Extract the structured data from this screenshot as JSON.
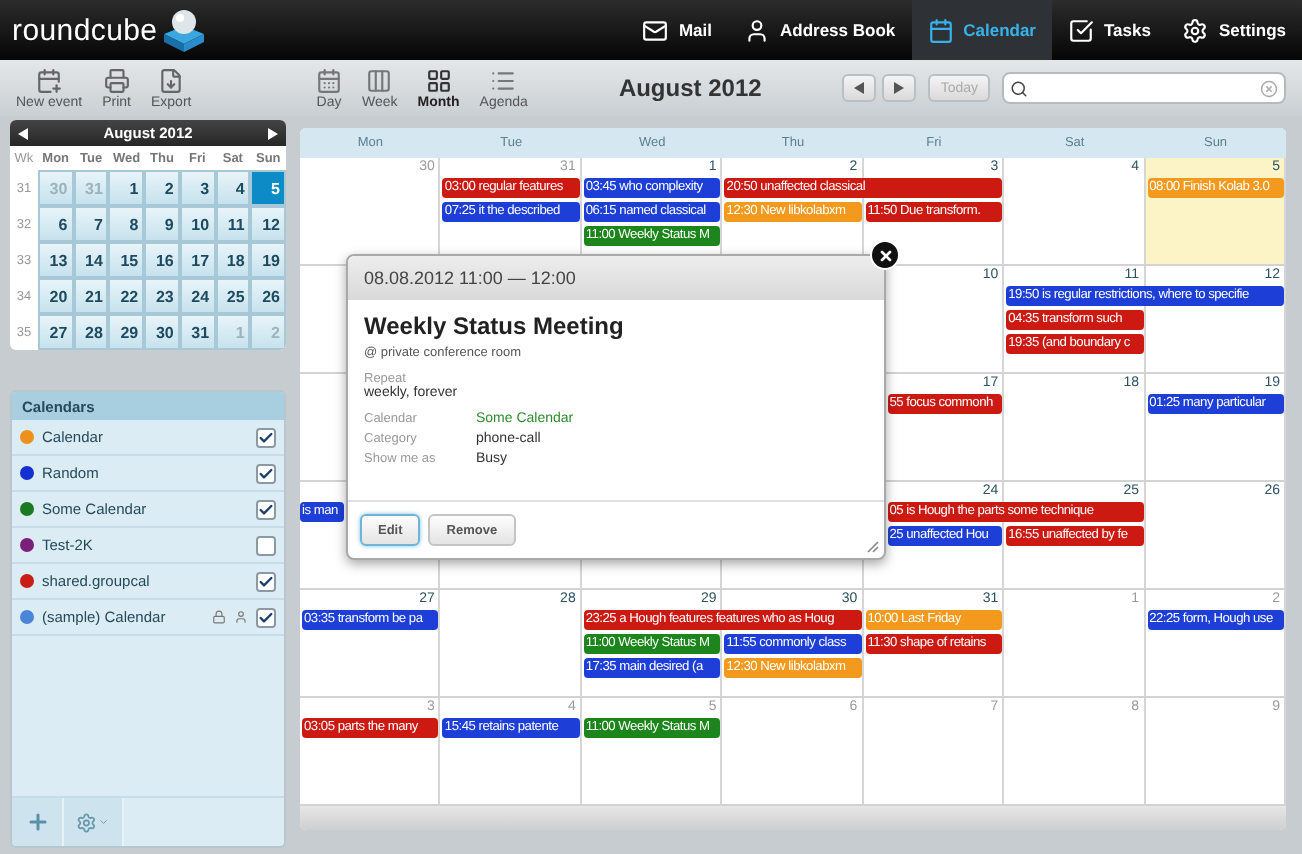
{
  "header": {
    "logo": "roundcube",
    "nav": [
      {
        "label": "Mail",
        "selected": false
      },
      {
        "label": "Address Book",
        "selected": false
      },
      {
        "label": "Calendar",
        "selected": true
      },
      {
        "label": "Tasks",
        "selected": false
      },
      {
        "label": "Settings",
        "selected": false
      }
    ]
  },
  "toolbar": {
    "actions": [
      "New event",
      "Print",
      "Export"
    ],
    "views": [
      {
        "label": "Day",
        "selected": false
      },
      {
        "label": "Week",
        "selected": false
      },
      {
        "label": "Month",
        "selected": true
      },
      {
        "label": "Agenda",
        "selected": false
      }
    ],
    "title": "August 2012",
    "today": {
      "label": "Today",
      "disabled": true
    }
  },
  "mini_calendar": {
    "title": "August 2012",
    "week_label": "Wk",
    "weekdays": [
      "Mon",
      "Tue",
      "Wed",
      "Thu",
      "Fri",
      "Sat",
      "Sun"
    ],
    "weeks": [
      {
        "number": "31",
        "days": [
          {
            "label": "30",
            "muted": true,
            "selected": false
          },
          {
            "label": "31",
            "muted": true,
            "selected": false
          },
          {
            "label": "1",
            "muted": false,
            "selected": false
          },
          {
            "label": "2",
            "muted": false,
            "selected": false
          },
          {
            "label": "3",
            "muted": false,
            "selected": false
          },
          {
            "label": "4",
            "muted": false,
            "selected": false
          },
          {
            "label": "5",
            "muted": false,
            "selected": true
          }
        ]
      },
      {
        "number": "32",
        "days": [
          {
            "label": "6",
            "muted": false,
            "selected": false
          },
          {
            "label": "7",
            "muted": false,
            "selected": false
          },
          {
            "label": "8",
            "muted": false,
            "selected": false
          },
          {
            "label": "9",
            "muted": false,
            "selected": false
          },
          {
            "label": "10",
            "muted": false,
            "selected": false
          },
          {
            "label": "11",
            "muted": false,
            "selected": false
          },
          {
            "label": "12",
            "muted": false,
            "selected": false
          }
        ]
      },
      {
        "number": "33",
        "days": [
          {
            "label": "13",
            "muted": false,
            "selected": false
          },
          {
            "label": "14",
            "muted": false,
            "selected": false
          },
          {
            "label": "15",
            "muted": false,
            "selected": false
          },
          {
            "label": "16",
            "muted": false,
            "selected": false
          },
          {
            "label": "17",
            "muted": false,
            "selected": false
          },
          {
            "label": "18",
            "muted": false,
            "selected": false
          },
          {
            "label": "19",
            "muted": false,
            "selected": false
          }
        ]
      },
      {
        "number": "34",
        "days": [
          {
            "label": "20",
            "muted": false,
            "selected": false
          },
          {
            "label": "21",
            "muted": false,
            "selected": false
          },
          {
            "label": "22",
            "muted": false,
            "selected": false
          },
          {
            "label": "23",
            "muted": false,
            "selected": false
          },
          {
            "label": "24",
            "muted": false,
            "selected": false
          },
          {
            "label": "25",
            "muted": false,
            "selected": false
          },
          {
            "label": "26",
            "muted": false,
            "selected": false
          }
        ]
      },
      {
        "number": "35",
        "days": [
          {
            "label": "27",
            "muted": false,
            "selected": false
          },
          {
            "label": "28",
            "muted": false,
            "selected": false
          },
          {
            "label": "29",
            "muted": false,
            "selected": false
          },
          {
            "label": "30",
            "muted": false,
            "selected": false
          },
          {
            "label": "31",
            "muted": false,
            "selected": false
          },
          {
            "label": "1",
            "muted": true,
            "selected": false
          },
          {
            "label": "2",
            "muted": true,
            "selected": false
          }
        ]
      }
    ]
  },
  "calendars": {
    "title": "Calendars",
    "items": [
      {
        "name": "Calendar",
        "color": "#f0901c",
        "checked": true,
        "shared": false
      },
      {
        "name": "Random",
        "color": "#1530d0",
        "checked": true,
        "shared": false
      },
      {
        "name": "Some Calendar",
        "color": "#1a7a22",
        "checked": true,
        "shared": false
      },
      {
        "name": "Test-2K",
        "color": "#7a1f7a",
        "checked": false,
        "shared": false
      },
      {
        "name": "shared.groupcal",
        "color": "#c81e14",
        "checked": true,
        "shared": false
      },
      {
        "name": "(sample) Calendar",
        "color": "#4a86d8",
        "checked": true,
        "shared": true
      }
    ]
  },
  "calendar": {
    "weekdays": [
      "Mon",
      "Tue",
      "Wed",
      "Thu",
      "Fri",
      "Sat",
      "Sun"
    ],
    "weeks": [
      {
        "kind": "full",
        "days": [
          {
            "date": "30",
            "muted": true,
            "today": false
          },
          {
            "date": "31",
            "muted": true,
            "today": false,
            "events": [
              {
                "text": "03:00 regular features",
                "color": "#cc1a12",
                "kind": "single"
              },
              {
                "text": "07:25 it the described",
                "color": "#1d3fd8",
                "kind": "single"
              }
            ]
          },
          {
            "date": "1",
            "muted": false,
            "today": false,
            "events": [
              {
                "text": "03:45 who complexity",
                "color": "#1d3fd8",
                "kind": "single"
              },
              {
                "text": "06:15 named classical",
                "color": "#1d3fd8",
                "kind": "single"
              },
              {
                "text": "11:00 Weekly Status M",
                "color": "#1c861c",
                "kind": "single"
              }
            ]
          },
          {
            "date": "2",
            "muted": false,
            "today": false,
            "events": [
              {
                "text": "20:50 unaffected classical",
                "color": "#cc1a12",
                "kind": "two-day"
              },
              {
                "text": "12:30 New libkolabxm",
                "color": "#f39a1e",
                "kind": "single"
              }
            ]
          },
          {
            "date": "3",
            "muted": false,
            "today": false,
            "events": [
              {
                "text": "11:50 Due transform.",
                "color": "#cc1a12",
                "kind": "single"
              }
            ]
          },
          {
            "date": "4",
            "muted": false,
            "today": false
          },
          {
            "date": "5",
            "muted": false,
            "today": true,
            "events": [
              {
                "text": "08:00 Finish Kolab 3.0",
                "color": "#f39a1e",
                "kind": "single"
              }
            ]
          }
        ]
      },
      {
        "kind": "partly-covered",
        "days": [
          {
            "date": "10",
            "muted": false,
            "today": false
          },
          {
            "date": "11",
            "muted": false,
            "today": false,
            "events": [
              {
                "text": "19:50 is regular restrictions, where to specifie",
                "color": "#1d3fd8",
                "kind": "two-day"
              },
              {
                "text": "04:35 transform such",
                "color": "#cc1a12",
                "kind": "single"
              },
              {
                "text": "19:35 (and boundary c",
                "color": "#cc1a12",
                "kind": "single"
              }
            ]
          },
          {
            "date": "12",
            "muted": false,
            "today": false
          }
        ]
      },
      {
        "kind": "partly-covered",
        "days": [
          {
            "date": "17",
            "muted": false,
            "today": false,
            "events": [
              {
                "text": "55 focus commonh",
                "color": "#cc1a12",
                "kind": "clipped"
              }
            ]
          },
          {
            "date": "18",
            "muted": false,
            "today": false
          },
          {
            "date": "19",
            "muted": false,
            "today": false,
            "events": [
              {
                "text": "01:25 many particular",
                "color": "#1d3fd8",
                "kind": "single"
              }
            ]
          }
        ]
      },
      {
        "kind": "partly-covered",
        "left_events": [
          {
            "text": "is man",
            "color": "#1d3fd8",
            "kind": "cut-right"
          }
        ],
        "days": [
          {
            "date": "24",
            "muted": false,
            "today": false,
            "events": [
              {
                "text": "05 is Hough the parts some technique",
                "color": "#cc1a12",
                "kind": "clipped-two-day"
              },
              {
                "text": "25 unaffected Hou",
                "color": "#1d3fd8",
                "kind": "clipped"
              }
            ]
          },
          {
            "date": "25",
            "muted": false,
            "today": false,
            "events": [
              {
                "text": "16:55 unaffected by fe",
                "color": "#cc1a12",
                "kind": "single"
              }
            ]
          },
          {
            "date": "26",
            "muted": false,
            "today": false
          }
        ]
      },
      {
        "kind": "full",
        "days": [
          {
            "date": "27",
            "muted": false,
            "today": false,
            "events": [
              {
                "text": "03:35 transform be pa",
                "color": "#1d3fd8",
                "kind": "single"
              }
            ]
          },
          {
            "date": "28",
            "muted": false,
            "today": false
          },
          {
            "date": "29",
            "muted": false,
            "today": false,
            "events": [
              {
                "text": "23:25 a Hough features features who as Houg",
                "color": "#cc1a12",
                "kind": "two-day"
              },
              {
                "text": "11:00 Weekly Status M",
                "color": "#1c861c",
                "kind": "single"
              },
              {
                "text": "17:35 main desired (a",
                "color": "#1d3fd8",
                "kind": "single"
              }
            ]
          },
          {
            "date": "30",
            "muted": false,
            "today": false,
            "events": [
              {
                "text": "11:55 commonly class",
                "color": "#1d3fd8",
                "kind": "single"
              },
              {
                "text": "12:30 New libkolabxm",
                "color": "#f39a1e",
                "kind": "single"
              }
            ]
          },
          {
            "date": "31",
            "muted": false,
            "today": false,
            "events": [
              {
                "text": "10:00 Last Friday",
                "color": "#f39a1e",
                "kind": "single"
              },
              {
                "text": "11:30 shape of retains",
                "color": "#cc1a12",
                "kind": "single"
              }
            ]
          },
          {
            "date": "1",
            "muted": true,
            "today": false
          },
          {
            "date": "2",
            "muted": true,
            "today": false,
            "events": [
              {
                "text": "22:25 form, Hough use",
                "color": "#1d3fd8",
                "kind": "single"
              }
            ]
          }
        ]
      },
      {
        "kind": "full",
        "days": [
          {
            "date": "3",
            "muted": true,
            "today": false,
            "events": [
              {
                "text": "03:05 parts the many",
                "color": "#cc1a12",
                "kind": "single"
              }
            ]
          },
          {
            "date": "4",
            "muted": true,
            "today": false,
            "events": [
              {
                "text": "15:45 retains patente",
                "color": "#1d3fd8",
                "kind": "single"
              }
            ]
          },
          {
            "date": "5",
            "muted": true,
            "today": false,
            "events": [
              {
                "text": "11:00 Weekly Status M",
                "color": "#1c861c",
                "kind": "single"
              }
            ]
          },
          {
            "date": "6",
            "muted": true,
            "today": false
          },
          {
            "date": "7",
            "muted": true,
            "today": false
          },
          {
            "date": "8",
            "muted": true,
            "today": false
          },
          {
            "date": "9",
            "muted": true,
            "today": false
          }
        ]
      }
    ]
  },
  "event_popup": {
    "datetime": "08.08.2012 11:00 — 12:00",
    "title": "Weekly Status Meeting",
    "location": "@ private conference room",
    "repeat_label": "Repeat",
    "repeat": "weekly, forever",
    "fields": [
      {
        "label": "Calendar",
        "value": "Some Calendar",
        "color": "#2e8a2e"
      },
      {
        "label": "Category",
        "value": "phone-call",
        "color": "#333333"
      },
      {
        "label": "Show me as",
        "value": "Busy",
        "color": "#333333"
      }
    ],
    "buttons": [
      {
        "label": "Edit",
        "focused": true
      },
      {
        "label": "Remove",
        "focused": false
      }
    ]
  }
}
